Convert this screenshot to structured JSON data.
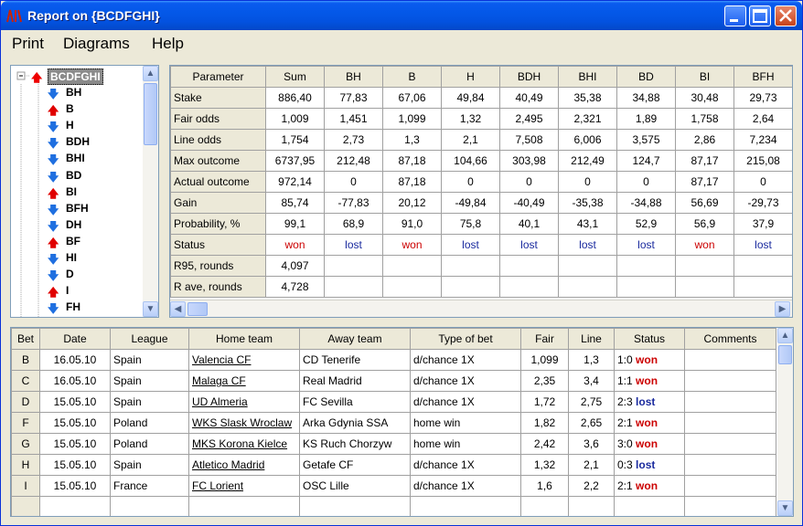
{
  "window": {
    "title": "Report on {BCDFGHI}",
    "accent": "#0458e8"
  },
  "menu": [
    "Print",
    "Diagrams",
    "Help"
  ],
  "tree": {
    "root": {
      "label": "BCDFGHI",
      "dir": "up"
    },
    "items": [
      {
        "label": "BH",
        "dir": "down"
      },
      {
        "label": "B",
        "dir": "up"
      },
      {
        "label": "H",
        "dir": "down"
      },
      {
        "label": "BDH",
        "dir": "down"
      },
      {
        "label": "BHI",
        "dir": "down"
      },
      {
        "label": "BD",
        "dir": "down"
      },
      {
        "label": "BI",
        "dir": "up"
      },
      {
        "label": "BFH",
        "dir": "down"
      },
      {
        "label": "DH",
        "dir": "down"
      },
      {
        "label": "BF",
        "dir": "up"
      },
      {
        "label": "HI",
        "dir": "down"
      },
      {
        "label": "D",
        "dir": "down"
      },
      {
        "label": "I",
        "dir": "up"
      },
      {
        "label": "FH",
        "dir": "down"
      }
    ]
  },
  "summary": {
    "columns": [
      "Parameter",
      "Sum",
      "BH",
      "B",
      "H",
      "BDH",
      "BHI",
      "BD",
      "BI",
      "BFH"
    ],
    "rows": [
      {
        "label": "Stake",
        "values": [
          "886,40",
          "77,83",
          "67,06",
          "49,84",
          "40,49",
          "35,38",
          "34,88",
          "30,48",
          "29,73"
        ]
      },
      {
        "label": "Fair odds",
        "values": [
          "1,009",
          "1,451",
          "1,099",
          "1,32",
          "2,495",
          "2,321",
          "1,89",
          "1,758",
          "2,64"
        ]
      },
      {
        "label": "Line odds",
        "values": [
          "1,754",
          "2,73",
          "1,3",
          "2,1",
          "7,508",
          "6,006",
          "3,575",
          "2,86",
          "7,234"
        ]
      },
      {
        "label": "Max outcome",
        "values": [
          "6737,95",
          "212,48",
          "87,18",
          "104,66",
          "303,98",
          "212,49",
          "124,7",
          "87,17",
          "215,08"
        ]
      },
      {
        "label": "Actual outcome",
        "values": [
          "972,14",
          "0",
          "87,18",
          "0",
          "0",
          "0",
          "0",
          "87,17",
          "0"
        ]
      },
      {
        "label": "Gain",
        "values": [
          "85,74",
          "-77,83",
          "20,12",
          "-49,84",
          "-40,49",
          "-35,38",
          "-34,88",
          "56,69",
          "-29,73"
        ]
      },
      {
        "label": "Probability, %",
        "values": [
          "99,1",
          "68,9",
          "91,0",
          "75,8",
          "40,1",
          "43,1",
          "52,9",
          "56,9",
          "37,9"
        ]
      },
      {
        "label": "Status",
        "values": [
          "won",
          "lost",
          "won",
          "lost",
          "lost",
          "lost",
          "lost",
          "won",
          "lost"
        ]
      },
      {
        "label": "R95, rounds",
        "values": [
          "4,097",
          "",
          "",
          "",
          "",
          "",
          "",
          "",
          ""
        ]
      },
      {
        "label": "R ave, rounds",
        "values": [
          "4,728",
          "",
          "",
          "",
          "",
          "",
          "",
          "",
          ""
        ]
      }
    ]
  },
  "bets": {
    "columns": [
      "Bet",
      "Date",
      "League",
      "Home team",
      "Away team",
      "Type of bet",
      "Fair",
      "Line",
      "Status",
      "Comments"
    ],
    "rows": [
      {
        "bet": "B",
        "date": "16.05.10",
        "league": "Spain",
        "home": "Valencia CF",
        "away": "CD Tenerife",
        "type": "d/chance 1X",
        "fair": "1,099",
        "line": "1,3",
        "score": "1:0",
        "status": "won",
        "comments": ""
      },
      {
        "bet": "C",
        "date": "16.05.10",
        "league": "Spain",
        "home": "Malaga CF",
        "away": "Real Madrid",
        "type": "d/chance 1X",
        "fair": "2,35",
        "line": "3,4",
        "score": "1:1",
        "status": "won",
        "comments": ""
      },
      {
        "bet": "D",
        "date": "15.05.10",
        "league": "Spain",
        "home": "UD Almeria",
        "away": "FC Sevilla",
        "type": "d/chance 1X",
        "fair": "1,72",
        "line": "2,75",
        "score": "2:3",
        "status": "lost",
        "comments": ""
      },
      {
        "bet": "F",
        "date": "15.05.10",
        "league": "Poland",
        "home": "WKS Slask Wroclaw",
        "away": "Arka Gdynia SSA",
        "type": "home win",
        "fair": "1,82",
        "line": "2,65",
        "score": "2:1",
        "status": "won",
        "comments": ""
      },
      {
        "bet": "G",
        "date": "15.05.10",
        "league": "Poland",
        "home": "MKS Korona Kielce",
        "away": "KS Ruch Chorzyw",
        "type": "home win",
        "fair": "2,42",
        "line": "3,6",
        "score": "3:0",
        "status": "won",
        "comments": ""
      },
      {
        "bet": "H",
        "date": "15.05.10",
        "league": "Spain",
        "home": "Atletico Madrid",
        "away": "Getafe CF",
        "type": "d/chance 1X",
        "fair": "1,32",
        "line": "2,1",
        "score": "0:3",
        "status": "lost",
        "comments": ""
      },
      {
        "bet": "I",
        "date": "15.05.10",
        "league": "France",
        "home": "FC Lorient",
        "away": "OSC Lille",
        "type": "d/chance 1X",
        "fair": "1,6",
        "line": "2,2",
        "score": "2:1",
        "status": "won",
        "comments": ""
      }
    ]
  },
  "colors": {
    "won": "#c00000",
    "lost": "#1a2a9e",
    "up_arrow": "#e00000",
    "down_arrow": "#1f6fe0"
  }
}
